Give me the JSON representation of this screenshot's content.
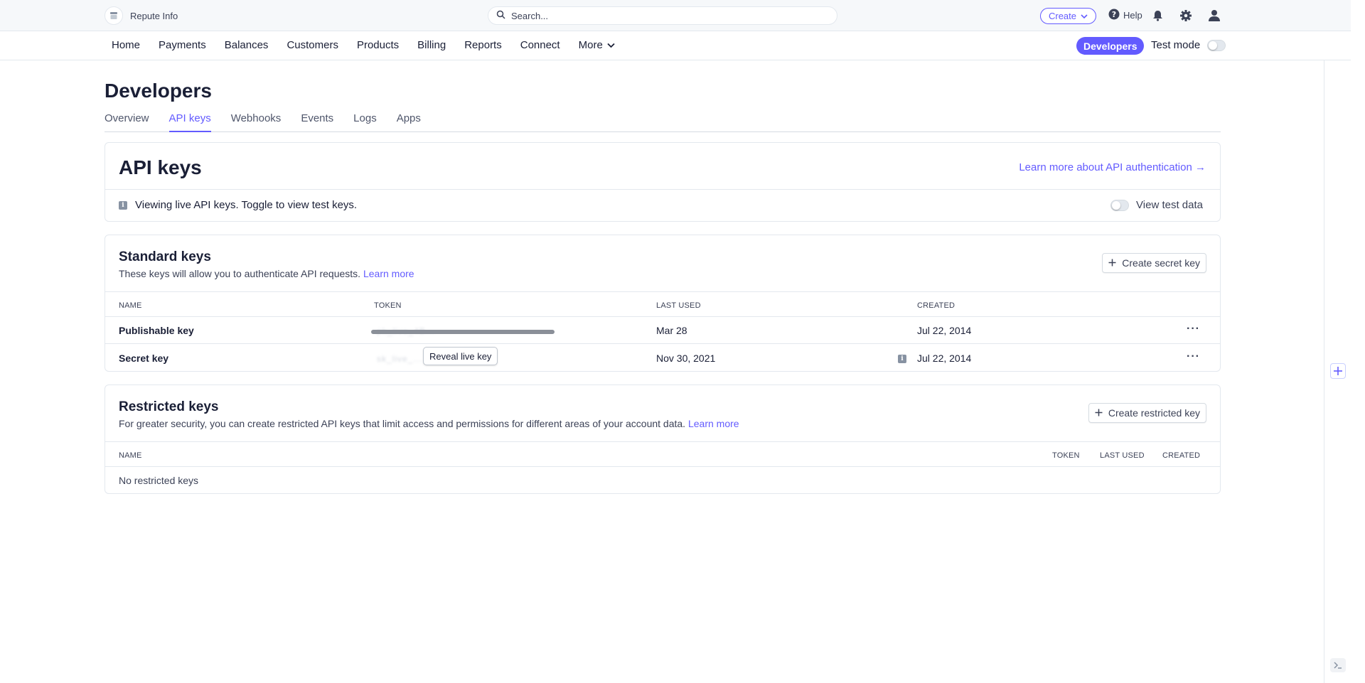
{
  "topbar": {
    "account_name": "Repute Info",
    "search_placeholder": "Search...",
    "create_label": "Create",
    "help_label": "Help"
  },
  "nav": {
    "items": [
      "Home",
      "Payments",
      "Balances",
      "Customers",
      "Products",
      "Billing",
      "Reports",
      "Connect",
      "More"
    ],
    "developers_label": "Developers",
    "test_mode_label": "Test mode"
  },
  "page": {
    "title": "Developers",
    "tabs": [
      "Overview",
      "API keys",
      "Webhooks",
      "Events",
      "Logs",
      "Apps"
    ],
    "active_tab": "API keys"
  },
  "api_keys": {
    "title": "API keys",
    "learn_link": "Learn more about API authentication →",
    "info_text": "Viewing live API keys. Toggle to view test keys.",
    "view_test_label": "View test data"
  },
  "standard_keys": {
    "title": "Standard keys",
    "description": "These keys will allow you to authenticate API requests.",
    "learn_more": "Learn more",
    "create_button": "Create secret key",
    "columns": [
      "NAME",
      "TOKEN",
      "LAST USED",
      "CREATED"
    ],
    "rows": [
      {
        "name": "Publishable key",
        "token": "pk_live_4B...",
        "last_used": "Mar 28",
        "created": "Jul 22, 2014"
      },
      {
        "name": "Secret key",
        "token": "sk_live_...",
        "reveal_label": "Reveal live key",
        "last_used": "Nov 30, 2021",
        "created": "Jul 22, 2014"
      }
    ]
  },
  "restricted_keys": {
    "title": "Restricted keys",
    "description": "For greater security, you can create restricted API keys that limit access and permissions for different areas of your account data.",
    "learn_more": "Learn more",
    "create_button": "Create restricted key",
    "columns": [
      "NAME",
      "TOKEN",
      "LAST USED",
      "CREATED"
    ],
    "empty_text": "No restricted keys"
  },
  "colors": {
    "accent": "#635bff",
    "text": "#1a1f36",
    "border": "#e3e8ee"
  }
}
